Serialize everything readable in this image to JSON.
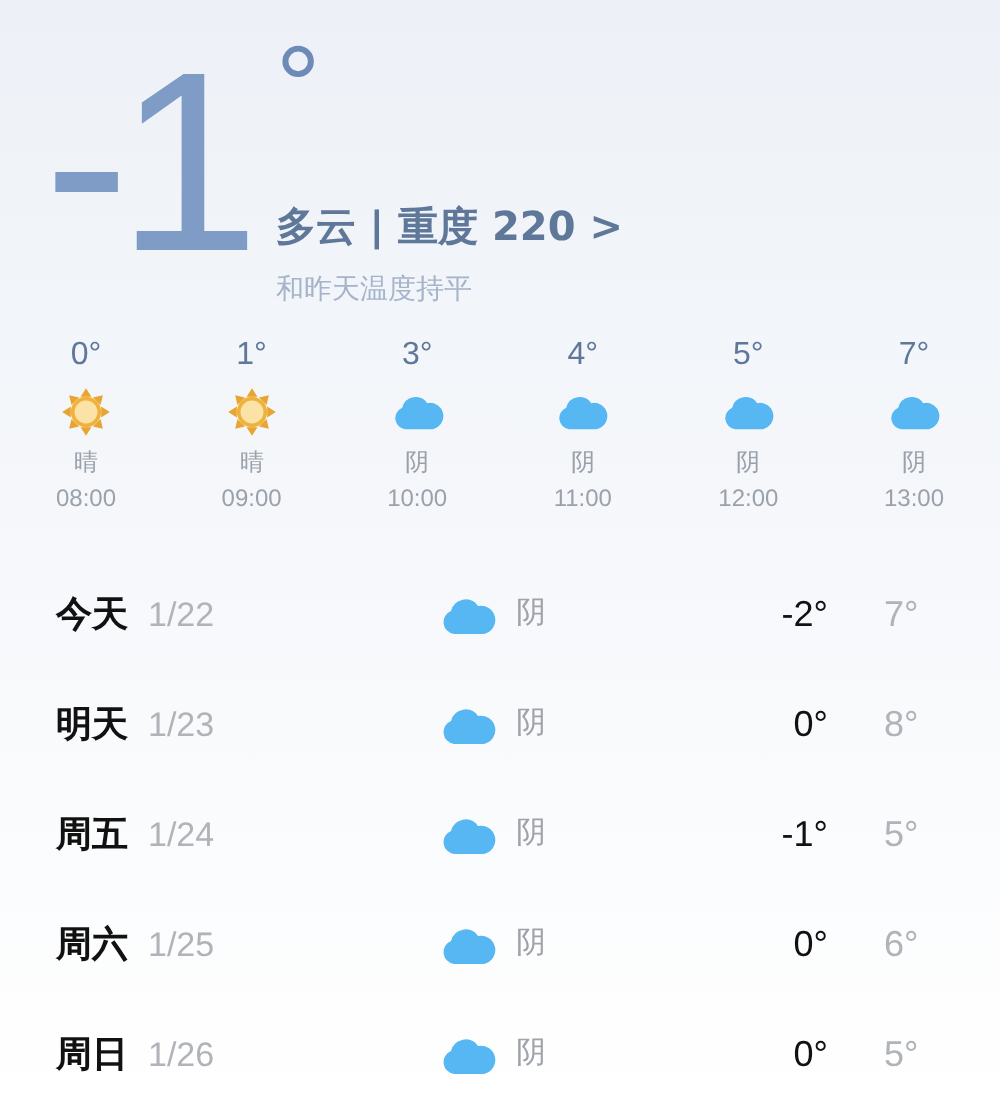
{
  "current": {
    "temperature": "-1",
    "degree": "°",
    "summary": "多云 | 重度 220 >",
    "comparison": "和昨天温度持平"
  },
  "hourly": [
    {
      "temp": "0°",
      "kind": "sunny",
      "condition": "晴",
      "time": "08:00"
    },
    {
      "temp": "1°",
      "kind": "sunny",
      "condition": "晴",
      "time": "09:00"
    },
    {
      "temp": "3°",
      "kind": "cloudy",
      "condition": "阴",
      "time": "10:00"
    },
    {
      "temp": "4°",
      "kind": "cloudy",
      "condition": "阴",
      "time": "11:00"
    },
    {
      "temp": "5°",
      "kind": "cloudy",
      "condition": "阴",
      "time": "12:00"
    },
    {
      "temp": "7°",
      "kind": "cloudy",
      "condition": "阴",
      "time": "13:00"
    }
  ],
  "daily": [
    {
      "day": "今天",
      "date": "1/22",
      "kind": "cloudy",
      "condition": "阴",
      "low": "-2°",
      "high": "7°"
    },
    {
      "day": "明天",
      "date": "1/23",
      "kind": "cloudy",
      "condition": "阴",
      "low": "0°",
      "high": "8°"
    },
    {
      "day": "周五",
      "date": "1/24",
      "kind": "cloudy",
      "condition": "阴",
      "low": "-1°",
      "high": "5°"
    },
    {
      "day": "周六",
      "date": "1/25",
      "kind": "cloudy",
      "condition": "阴",
      "low": "0°",
      "high": "6°"
    },
    {
      "day": "周日",
      "date": "1/26",
      "kind": "cloudy",
      "condition": "阴",
      "low": "0°",
      "high": "5°"
    }
  ]
}
